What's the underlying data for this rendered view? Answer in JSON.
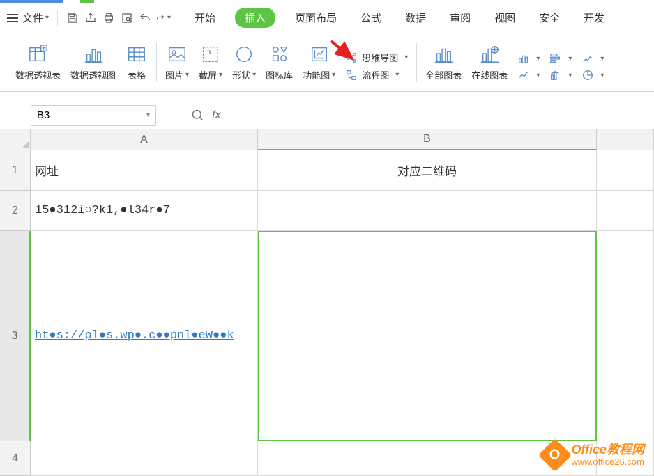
{
  "menu": {
    "file_label": "文件",
    "tabs": [
      "开始",
      "插入",
      "页面布局",
      "公式",
      "数据",
      "审阅",
      "视图",
      "安全",
      "开发"
    ]
  },
  "ribbon": {
    "pivot_table": "数据透视表",
    "pivot_chart": "数据透视图",
    "table": "表格",
    "picture": "图片",
    "screenshot": "截屏",
    "shapes": "形状",
    "icon_lib": "图标库",
    "func_chart": "功能图",
    "mindmap": "思维导图",
    "flowchart": "流程图",
    "all_charts": "全部图表",
    "online_chart": "在线图表"
  },
  "namebox": {
    "value": "B3"
  },
  "columns": {
    "A": "A",
    "B": "B"
  },
  "rows": {
    "1": {
      "num": "1",
      "A": "网址",
      "B": "对应二维码"
    },
    "2": {
      "num": "2",
      "A": "15●312i○?k1,●l34r●7",
      "B": ""
    },
    "3": {
      "num": "3",
      "A": "ht●s://pl●s.wp●.c●●pnl●eW●●k",
      "B": ""
    },
    "4": {
      "num": "4",
      "A": "",
      "B": ""
    }
  },
  "watermark": {
    "title": "Office教程网",
    "url": "www.office26.com"
  }
}
